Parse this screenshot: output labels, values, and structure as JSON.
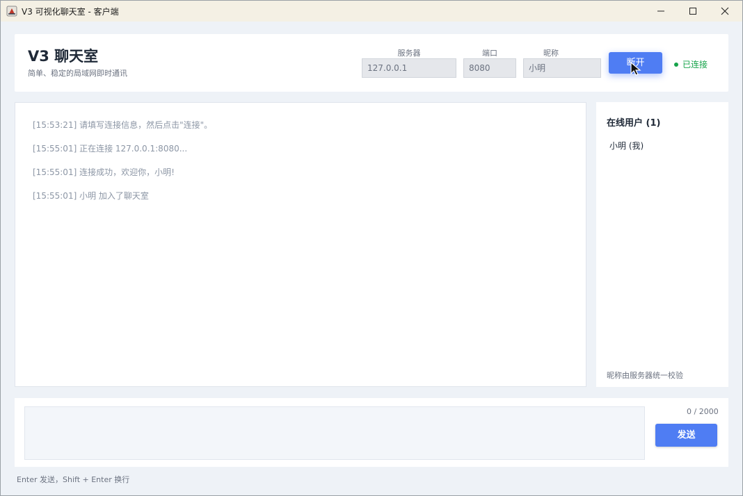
{
  "window": {
    "title": "V3 可视化聊天室 - 客户端",
    "controls": {
      "minimize": "—",
      "maximize": "☐",
      "close": "✕"
    }
  },
  "header": {
    "title": "V3 聊天室",
    "subtitle": "简单、稳定的局域网即时通讯",
    "server_label": "服务器",
    "server_value": "127.0.0.1",
    "port_label": "端口",
    "port_value": "8080",
    "nickname_label": "昵称",
    "nickname_value": "小明",
    "disconnect_label": "断开",
    "status_text": "已连接",
    "status_color": "#16a34a",
    "accent_color": "#4f7df3"
  },
  "chat": {
    "messages": [
      "[15:53:21] 请填写连接信息，然后点击\"连接\"。",
      "[15:55:01] 正在连接 127.0.0.1:8080...",
      "[15:55:01] 连接成功，欢迎你，小明!",
      "[15:55:01] 小明 加入了聊天室"
    ]
  },
  "users": {
    "title": "在线用户 (1)",
    "items": [
      "小明 (我)"
    ],
    "note": "昵称由服务器统一校验"
  },
  "composer": {
    "placeholder": "",
    "char_count": "0 / 2000",
    "send_label": "发送",
    "hint": "Enter 发送，Shift + Enter 换行"
  }
}
